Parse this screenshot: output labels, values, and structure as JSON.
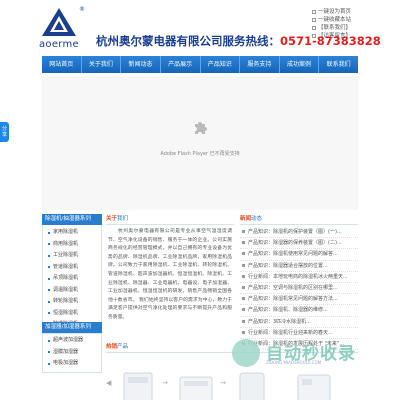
{
  "header": {
    "logo_text": "aoerme",
    "reg_mark": "®",
    "slogan_company": "杭州奥尔蒙电器有限公司服务热线：",
    "slogan_phone": "0571-87383828",
    "top_links": [
      "一键设为首页",
      "一键收藏本站",
      "【联系我们】",
      "【访客留言】"
    ]
  },
  "nav": {
    "items": [
      "网站首页",
      "关于我们",
      "新闻动态",
      "产品展示",
      "产品知识",
      "服务支持",
      "成功案例",
      "联系我们"
    ]
  },
  "side_tab": {
    "label": "分享"
  },
  "flash": {
    "message": "Adobe Flash Player 已不再受支持"
  },
  "left_categories": {
    "title": "除湿机/抽湿器系列",
    "items": [
      "家用除湿机",
      "商用除湿机",
      "工业除湿机",
      "管道除湿机",
      "吊顶除湿机",
      "调温除湿机",
      "转轮除湿机",
      "恒湿除湿机",
      "防爆除湿机"
    ]
  },
  "left_categories2": {
    "title": "加湿器/加湿器系列",
    "items": [
      "超声波加湿器",
      "湿膜加湿器",
      "电极加湿器"
    ]
  },
  "about": {
    "title_main": "关于",
    "title_rest": "我们",
    "more": "更多>>",
    "body": "杭州奥尔蒙电器有限公司是专业从事空气温湿度调节、空气净化设备的销售、服务于一体的企业。公司实施商务规化的经营管理模式，并以自己拥有的专业设备为优势的品牌、除湿机品牌、工业除湿机品牌，家用除湿机品牌。公司致力于家用除湿机、工业除湿机、转轮除湿机、管道除湿机、超声波加湿器机、恒湿恒温机、除湿机、工业除湿机、除湿器、工业电器机、电器设、电子加湿器、工业加湿器机、恒温恒湿机的研发，销售产品畅销全国各地十数省市。 我们始终坚持以客户的需求为中心，致力于满足客户提供对空气净化处理的要求与不断提升产品和服务质量。"
  },
  "news": {
    "title_main": "新闻",
    "title_rest": "动态",
    "items": [
      "产品知识：除湿机的保护装置（图）(一)...",
      "产品知识：除湿器的保养装置（图）(二)...",
      "产品知识：除湿机使用常见问题的解答...",
      "产品知识：除湿器适合摆放的位置...",
      "行业新闻：本地玩电商的除湿机冰火两重天...",
      "产品知识：空调与除湿机的区别在哪里...",
      "产品知识：除湿机常见问题的解答方法...",
      "产品知识：除湿机、除湿器的维修...",
      "产品知识：3匹冷水除湿机...",
      "行业新闻：除湿机行业迎来新的春天...",
      "行业新闻：除湿机的发展历程处于 \"未来\"..."
    ]
  },
  "products": {
    "title_main": "热销",
    "title_rest": "产品"
  },
  "watermark": {
    "text": "自动秒收录",
    "sub": "ZIDONG MIAOSHOULU.COM"
  }
}
